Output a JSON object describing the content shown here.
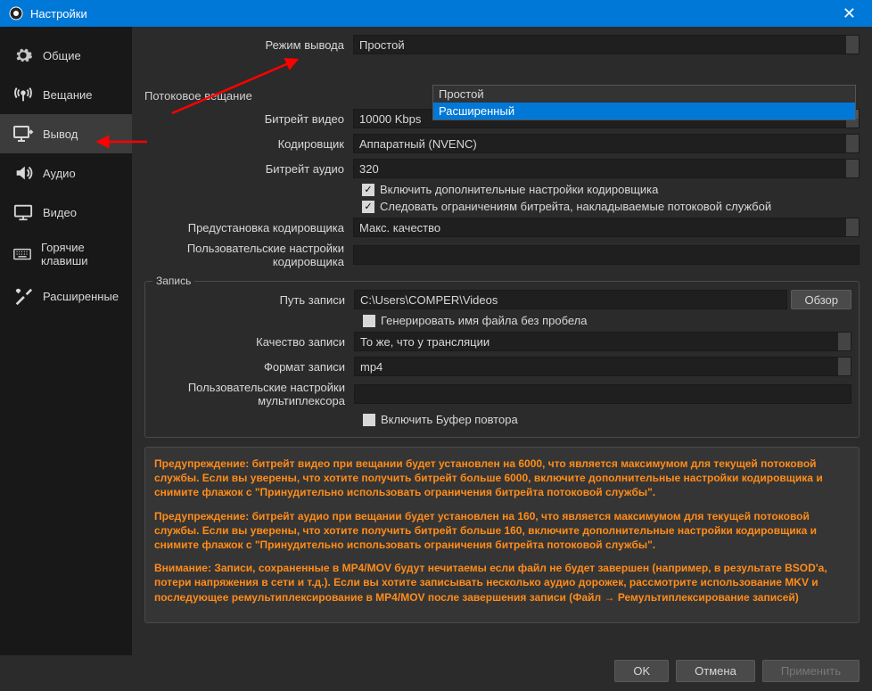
{
  "window": {
    "title": "Настройки",
    "close": "✕"
  },
  "sidebar": {
    "items": [
      {
        "label": "Общие"
      },
      {
        "label": "Вещание"
      },
      {
        "label": "Вывод"
      },
      {
        "label": "Аудио"
      },
      {
        "label": "Видео"
      },
      {
        "label": "Горячие клавиши"
      },
      {
        "label": "Расширенные"
      }
    ]
  },
  "output_mode": {
    "label": "Режим вывода",
    "value": "Простой",
    "options": [
      "Простой",
      "Расширенный"
    ]
  },
  "streaming": {
    "title": "Потоковое вещание",
    "video_bitrate_label": "Битрейт видео",
    "video_bitrate": "10000 Kbps",
    "encoder_label": "Кодировщик",
    "encoder": "Аппаратный (NVENC)",
    "audio_bitrate_label": "Битрейт аудио",
    "audio_bitrate": "320",
    "enable_advanced": "Включить дополнительные настройки кодировщика",
    "enforce_limits": "Следовать ограничениям битрейта, накладываемые потоковой службой",
    "preset_label": "Предустановка кодировщика",
    "preset": "Макс. качество",
    "custom_label": "Пользовательские настройки кодировщика"
  },
  "recording": {
    "title": "Запись",
    "path_label": "Путь записи",
    "path": "C:\\Users\\COMPER\\Videos",
    "browse": "Обзор",
    "no_space": "Генерировать имя файла без пробела",
    "quality_label": "Качество записи",
    "quality": "То же, что у трансляции",
    "format_label": "Формат записи",
    "format": "mp4",
    "mux_label": "Пользовательские настройки мультиплексора",
    "replay_buffer": "Включить Буфер повтора"
  },
  "warnings": {
    "w1": "Предупреждение: битрейт видео при вещании будет установлен на 6000, что является максимумом для текущей потоковой службы. Если вы уверены, что хотите получить битрейт больше 6000, включите дополнительные настройки кодировщика и снимите флажок с \"Принудительно использовать ограничения битрейта потоковой службы\".",
    "w2": "Предупреждение: битрейт аудио при вещании будет установлен на 160, что является максимумом для текущей потоковой службы. Если вы уверены, что хотите получить битрейт больше 160, включите дополнительные настройки кодировщика и снимите флажок с \"Принудительно использовать ограничения битрейта потоковой службы\".",
    "w3": "Внимание: Записи, сохраненные в MP4/MOV будут нечитаемы если файл не будет завершен (например, в результате BSOD'а, потери напряжения в сети и т.д.). Если вы хотите записывать несколько аудио дорожек, рассмотрите использование MKV и последующее ремультиплексирование в MP4/MOV после завершения записи (Файл → Ремультиплексирование записей)"
  },
  "footer": {
    "ok": "OK",
    "cancel": "Отмена",
    "apply": "Применить"
  }
}
